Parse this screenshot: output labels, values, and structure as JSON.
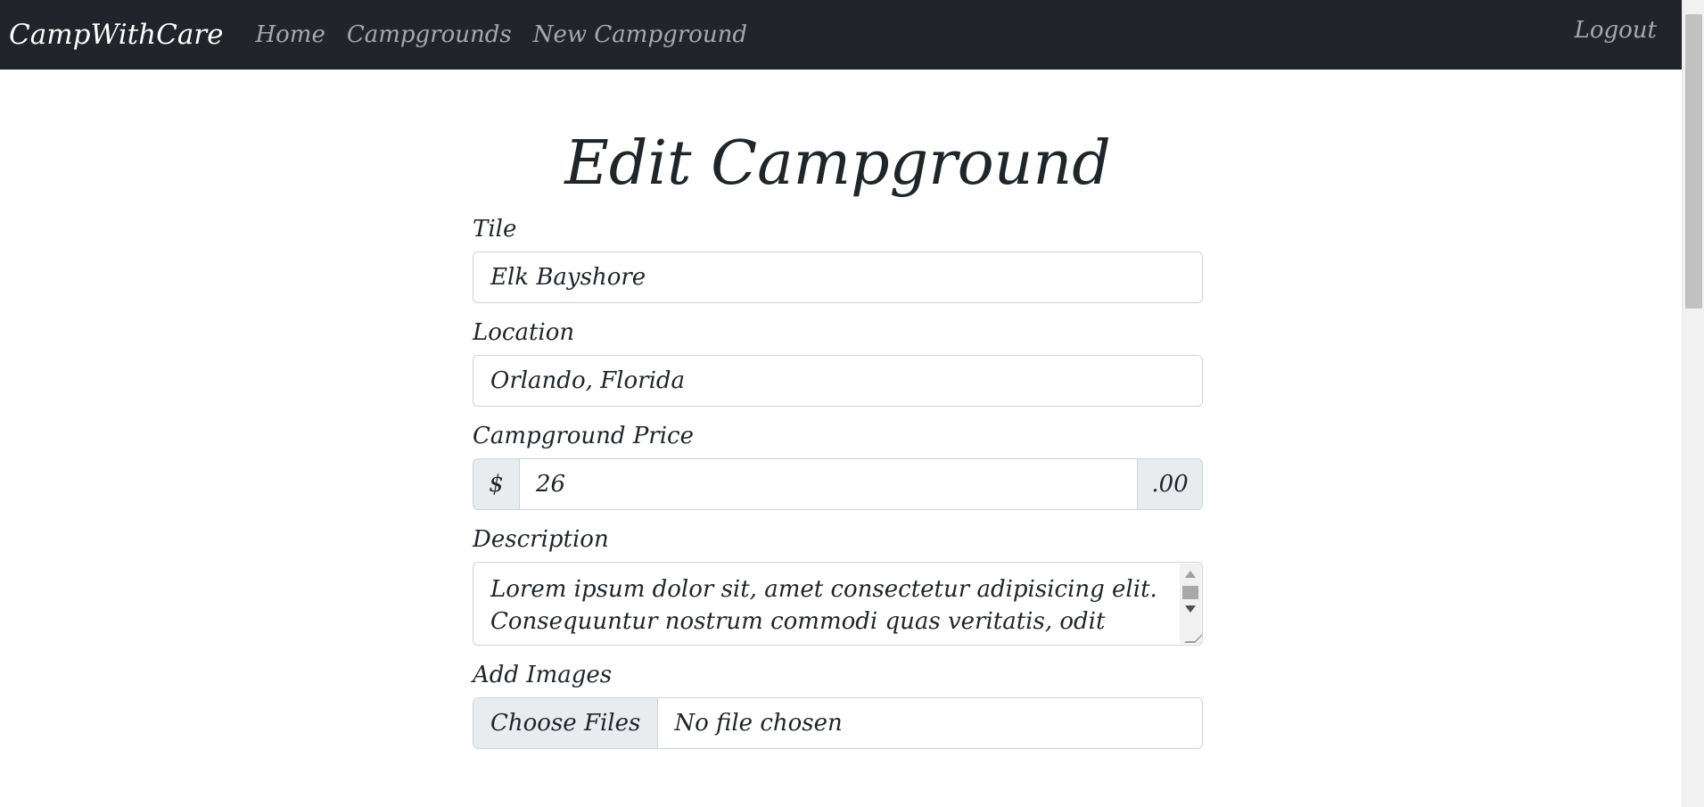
{
  "nav": {
    "brand": "CampWithCare",
    "links": [
      "Home",
      "Campgrounds",
      "New Campground"
    ],
    "logout": "Logout"
  },
  "page": {
    "title": "Edit Campground"
  },
  "form": {
    "title_label": "Tile",
    "title_value": "Elk Bayshore",
    "location_label": "Location",
    "location_value": "Orlando, Florida",
    "price_label": "Campground Price",
    "price_prefix": "$",
    "price_value": "26",
    "price_suffix": ".00",
    "description_label": "Description",
    "description_value": "Lorem ipsum dolor sit, amet consectetur adipisicing elit. Consequuntur nostrum commodi quas veritatis, odit quam",
    "images_label": "Add Images",
    "file_button": "Choose Files",
    "file_status": "No file chosen"
  }
}
